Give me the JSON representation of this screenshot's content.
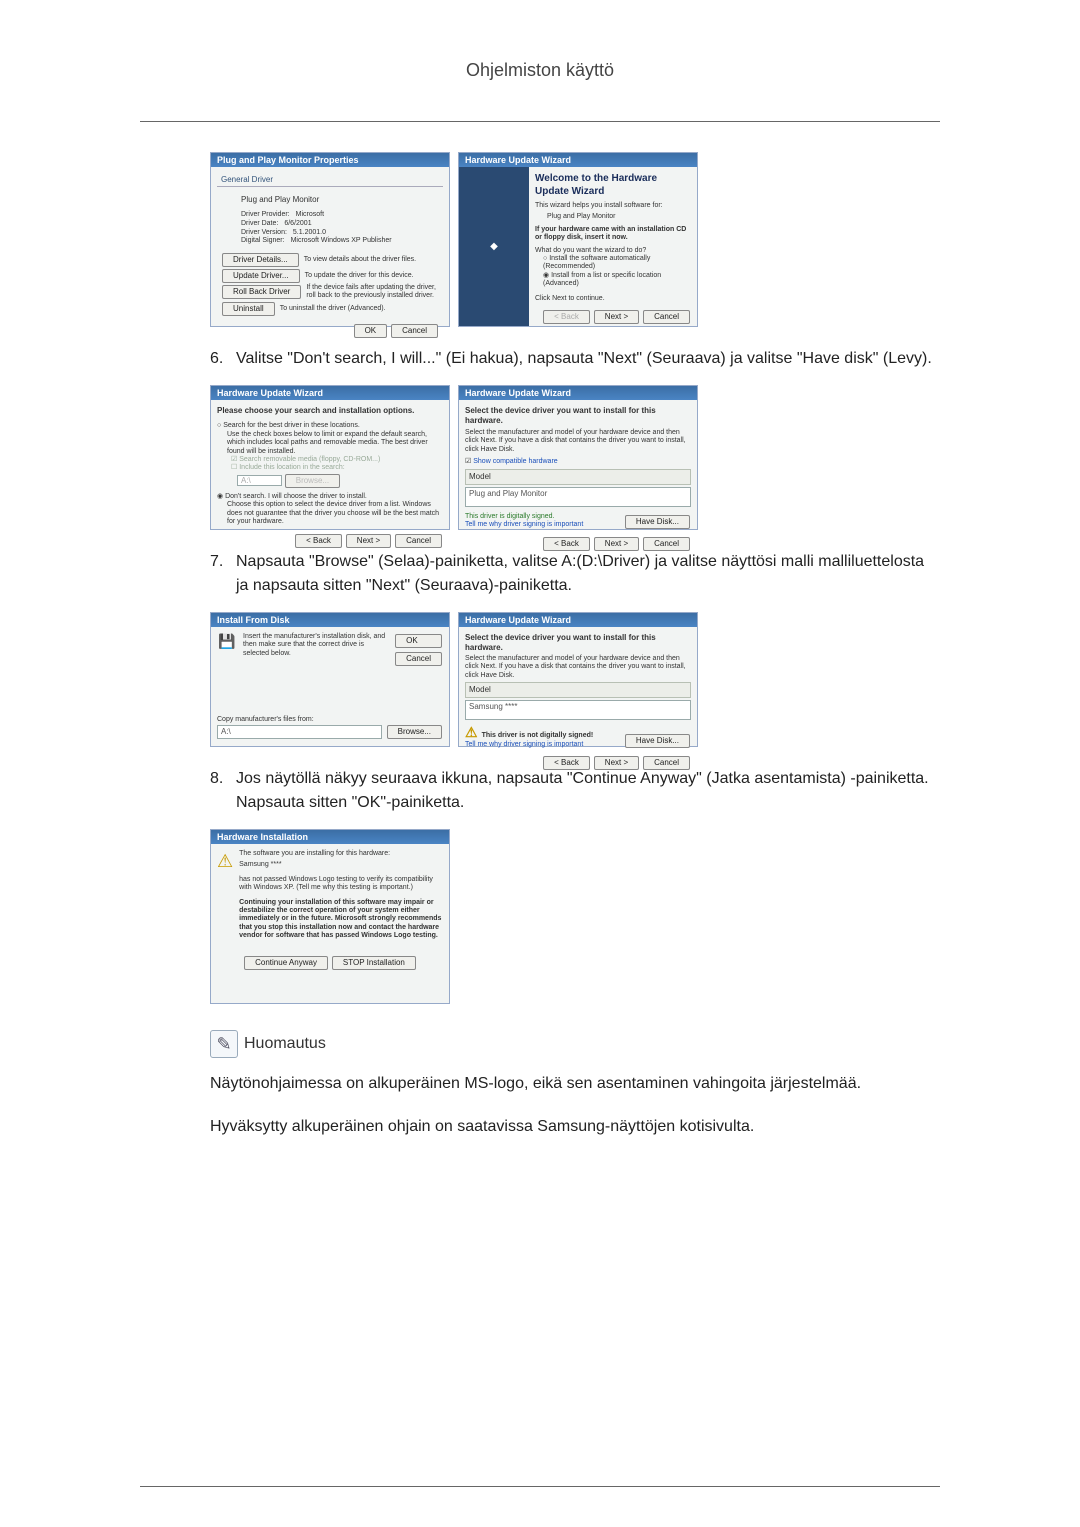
{
  "page_title": "Ohjelmiston käyttö",
  "step6": {
    "num": "6.",
    "text": "Valitse \"Don't search, I will...\" (Ei hakua), napsauta \"Next\" (Seuraava) ja valitse \"Have disk\" (Levy)."
  },
  "step7": {
    "num": "7.",
    "text": "Napsauta \"Browse\" (Selaa)-painiketta, valitse A:(D:\\Driver) ja valitse näyttösi malli malliluettelosta ja napsauta sitten \"Next\" (Seuraava)-painiketta."
  },
  "step8": {
    "num": "8.",
    "text": "Jos näytöllä näkyy seuraava ikkuna, napsauta \"Continue Anyway\" (Jatka asentamista) -painiketta. Napsauta sitten \"OK\"-painiketta."
  },
  "note": {
    "label": "Huomautus",
    "p1": "Näytönohjaimessa on alkuperäinen MS-logo, eikä sen asentaminen vahingoita järjestelmää.",
    "p2": "Hyväksytty alkuperäinen ohjain on saatavissa Samsung-näyttöjen kotisivulta."
  },
  "common": {
    "ok": "OK",
    "cancel": "Cancel",
    "back": "< Back",
    "next": "Next >",
    "browse": "Browse...",
    "have_disk": "Have Disk..."
  },
  "s1": {
    "title": "Plug and Play Monitor Properties",
    "tabs": "General  Driver",
    "device": "Plug and Play Monitor",
    "provider_l": "Driver Provider:",
    "provider_v": "Microsoft",
    "date_l": "Driver Date:",
    "date_v": "6/6/2001",
    "version_l": "Driver Version:",
    "version_v": "5.1.2001.0",
    "signer_l": "Digital Signer:",
    "signer_v": "Microsoft Windows XP Publisher",
    "btn_details": "Driver Details...",
    "btn_details_d": "To view details about the driver files.",
    "btn_update": "Update Driver...",
    "btn_update_d": "To update the driver for this device.",
    "btn_rollback": "Roll Back Driver",
    "btn_rollback_d": "If the device fails after updating the driver, roll back to the previously installed driver.",
    "btn_uninstall": "Uninstall",
    "btn_uninstall_d": "To uninstall the driver (Advanced)."
  },
  "s2": {
    "title": "Hardware Update Wizard",
    "heading": "Welcome to the Hardware Update Wizard",
    "line1": "This wizard helps you install software for:",
    "line2": "Plug and Play Monitor",
    "line3": "If your hardware came with an installation CD or floppy disk, insert it now.",
    "line4": "What do you want the wizard to do?",
    "opt1": "Install the software automatically (Recommended)",
    "opt2": "Install from a list or specific location (Advanced)",
    "line5": "Click Next to continue."
  },
  "s3": {
    "title": "Hardware Update Wizard",
    "heading": "Please choose your search and installation options.",
    "opt_search": "Search for the best driver in these locations.",
    "opt_search_d": "Use the check boxes below to limit or expand the default search, which includes local paths and removable media. The best driver found will be installed.",
    "chk1": "Search removable media (floppy, CD-ROM...)",
    "chk2": "Include this location in the search:",
    "path": "A:\\",
    "opt_dont": "Don't search. I will choose the driver to install.",
    "opt_dont_d": "Choose this option to select the device driver from a list. Windows does not guarantee that the driver you choose will be the best match for your hardware."
  },
  "s4": {
    "title": "Hardware Update Wizard",
    "heading": "Select the device driver you want to install for this hardware.",
    "instr": "Select the manufacturer and model of your hardware device and then click Next. If you have a disk that contains the driver you want to install, click Have Disk.",
    "show_compat": "Show compatible hardware",
    "model": "Model",
    "model_item": "Plug and Play Monitor",
    "signed": "This driver is digitally signed.",
    "tell": "Tell me why driver signing is important"
  },
  "s5": {
    "title": "Install From Disk",
    "instr": "Insert the manufacturer's installation disk, and then make sure that the correct drive is selected below.",
    "copy": "Copy manufacturer's files from:",
    "path": "A:\\"
  },
  "s6": {
    "title": "Hardware Update Wizard",
    "heading": "Select the device driver you want to install for this hardware.",
    "instr": "Select the manufacturer and model of your hardware device and then click Next. If you have a disk that contains the driver you want to install, click Have Disk.",
    "model": "Model",
    "model_item": "Samsung ****",
    "notsigned": "This driver is not digitally signed!",
    "tell": "Tell me why driver signing is important"
  },
  "s7": {
    "title": "Hardware Installation",
    "line1": "The software you are installing for this hardware:",
    "line2": "Samsung ****",
    "line3": "has not passed Windows Logo testing to verify its compatibility with Windows XP. (Tell me why this testing is important.)",
    "line4": "Continuing your installation of this software may impair or destabilize the correct operation of your system either immediately or in the future. Microsoft strongly recommends that you stop this installation now and contact the hardware vendor for software that has passed Windows Logo testing.",
    "btn_continue": "Continue Anyway",
    "btn_stop": "STOP Installation"
  }
}
